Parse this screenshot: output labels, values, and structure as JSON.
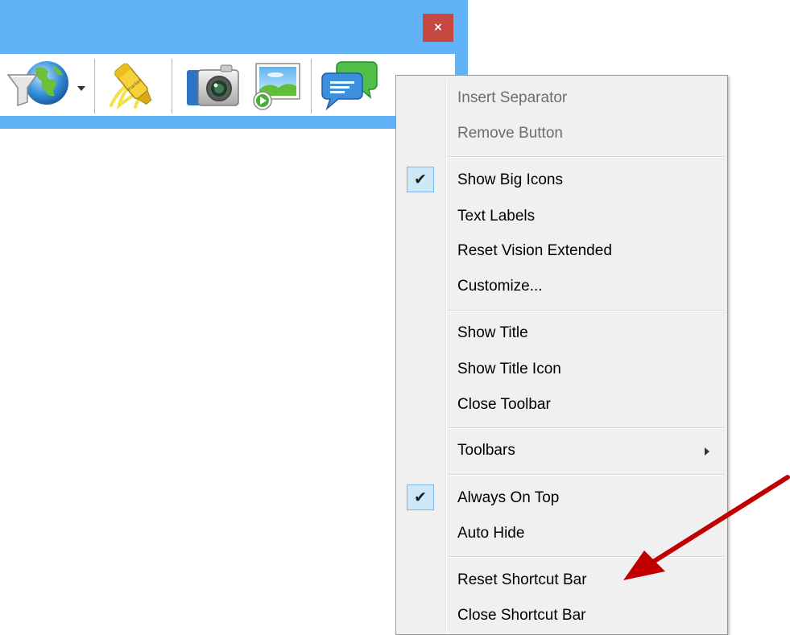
{
  "window": {
    "close_glyph": "×",
    "frame_color": "#62b2f7",
    "close_color": "#c7483f"
  },
  "toolbar": {
    "tools": [
      {
        "name": "web-filter-icon",
        "has_dropdown": true
      },
      {
        "name": "highlighter-icon",
        "has_dropdown": false
      },
      {
        "name": "camera-icon",
        "has_dropdown": false
      },
      {
        "name": "screen-share-icon",
        "has_dropdown": false
      },
      {
        "name": "chat-icon",
        "has_dropdown": false
      }
    ]
  },
  "menu": {
    "items": {
      "insert_separator": {
        "label": "Insert Separator",
        "enabled": false
      },
      "remove_button": {
        "label": "Remove Button",
        "enabled": false
      },
      "show_big_icons": {
        "label": "Show Big Icons",
        "checked": true
      },
      "text_labels": {
        "label": "Text Labels"
      },
      "reset_vision_extended": {
        "label": "Reset Vision Extended"
      },
      "customize": {
        "label": "Customize..."
      },
      "show_title": {
        "label": "Show Title"
      },
      "show_title_icon": {
        "label": "Show Title Icon"
      },
      "close_toolbar": {
        "label": "Close Toolbar"
      },
      "toolbars": {
        "label": "Toolbars",
        "has_submenu": true
      },
      "always_on_top": {
        "label": "Always On Top",
        "checked": true
      },
      "auto_hide": {
        "label": "Auto Hide"
      },
      "reset_shortcut_bar": {
        "label": "Reset Shortcut Bar"
      },
      "close_shortcut_bar": {
        "label": "Close Shortcut Bar"
      }
    },
    "check_glyph": "✔"
  },
  "annotation": {
    "arrow_color": "#c00000",
    "points_to": "reset_shortcut_bar"
  }
}
